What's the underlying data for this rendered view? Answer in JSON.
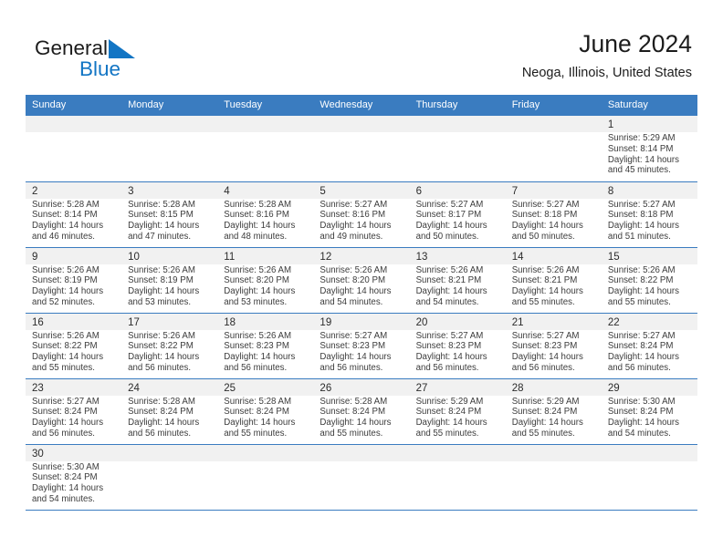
{
  "brand": {
    "name_dark": "General",
    "name_light": "Blue",
    "flag_icon": "blue-triangle-flag-icon",
    "accent_color": "#1275c4"
  },
  "header": {
    "title": "June 2024",
    "subtitle": "Neoga, Illinois, United States"
  },
  "theme": {
    "header_bg": "#3a7cc0",
    "header_text": "#ffffff",
    "cell_head_bg": "#f1f1f1",
    "grid_line": "#3a7cc0"
  },
  "weekdays": [
    "Sunday",
    "Monday",
    "Tuesday",
    "Wednesday",
    "Thursday",
    "Friday",
    "Saturday"
  ],
  "labels": {
    "sunrise_prefix": "Sunrise:",
    "sunset_prefix": "Sunset:",
    "daylight_prefix": "Daylight:"
  },
  "weeks": [
    [
      {
        "day": "",
        "empty": true,
        "sunrise": "",
        "sunset": "",
        "daylight_1": "",
        "daylight_2": ""
      },
      {
        "day": "",
        "empty": true,
        "sunrise": "",
        "sunset": "",
        "daylight_1": "",
        "daylight_2": ""
      },
      {
        "day": "",
        "empty": true,
        "sunrise": "",
        "sunset": "",
        "daylight_1": "",
        "daylight_2": ""
      },
      {
        "day": "",
        "empty": true,
        "sunrise": "",
        "sunset": "",
        "daylight_1": "",
        "daylight_2": ""
      },
      {
        "day": "",
        "empty": true,
        "sunrise": "",
        "sunset": "",
        "daylight_1": "",
        "daylight_2": ""
      },
      {
        "day": "",
        "empty": true,
        "sunrise": "",
        "sunset": "",
        "daylight_1": "",
        "daylight_2": ""
      },
      {
        "day": "1",
        "empty": false,
        "sunrise": "Sunrise: 5:29 AM",
        "sunset": "Sunset: 8:14 PM",
        "daylight_1": "Daylight: 14 hours",
        "daylight_2": "and 45 minutes."
      }
    ],
    [
      {
        "day": "2",
        "empty": false,
        "sunrise": "Sunrise: 5:28 AM",
        "sunset": "Sunset: 8:14 PM",
        "daylight_1": "Daylight: 14 hours",
        "daylight_2": "and 46 minutes."
      },
      {
        "day": "3",
        "empty": false,
        "sunrise": "Sunrise: 5:28 AM",
        "sunset": "Sunset: 8:15 PM",
        "daylight_1": "Daylight: 14 hours",
        "daylight_2": "and 47 minutes."
      },
      {
        "day": "4",
        "empty": false,
        "sunrise": "Sunrise: 5:28 AM",
        "sunset": "Sunset: 8:16 PM",
        "daylight_1": "Daylight: 14 hours",
        "daylight_2": "and 48 minutes."
      },
      {
        "day": "5",
        "empty": false,
        "sunrise": "Sunrise: 5:27 AM",
        "sunset": "Sunset: 8:16 PM",
        "daylight_1": "Daylight: 14 hours",
        "daylight_2": "and 49 minutes."
      },
      {
        "day": "6",
        "empty": false,
        "sunrise": "Sunrise: 5:27 AM",
        "sunset": "Sunset: 8:17 PM",
        "daylight_1": "Daylight: 14 hours",
        "daylight_2": "and 50 minutes."
      },
      {
        "day": "7",
        "empty": false,
        "sunrise": "Sunrise: 5:27 AM",
        "sunset": "Sunset: 8:18 PM",
        "daylight_1": "Daylight: 14 hours",
        "daylight_2": "and 50 minutes."
      },
      {
        "day": "8",
        "empty": false,
        "sunrise": "Sunrise: 5:27 AM",
        "sunset": "Sunset: 8:18 PM",
        "daylight_1": "Daylight: 14 hours",
        "daylight_2": "and 51 minutes."
      }
    ],
    [
      {
        "day": "9",
        "empty": false,
        "sunrise": "Sunrise: 5:26 AM",
        "sunset": "Sunset: 8:19 PM",
        "daylight_1": "Daylight: 14 hours",
        "daylight_2": "and 52 minutes."
      },
      {
        "day": "10",
        "empty": false,
        "sunrise": "Sunrise: 5:26 AM",
        "sunset": "Sunset: 8:19 PM",
        "daylight_1": "Daylight: 14 hours",
        "daylight_2": "and 53 minutes."
      },
      {
        "day": "11",
        "empty": false,
        "sunrise": "Sunrise: 5:26 AM",
        "sunset": "Sunset: 8:20 PM",
        "daylight_1": "Daylight: 14 hours",
        "daylight_2": "and 53 minutes."
      },
      {
        "day": "12",
        "empty": false,
        "sunrise": "Sunrise: 5:26 AM",
        "sunset": "Sunset: 8:20 PM",
        "daylight_1": "Daylight: 14 hours",
        "daylight_2": "and 54 minutes."
      },
      {
        "day": "13",
        "empty": false,
        "sunrise": "Sunrise: 5:26 AM",
        "sunset": "Sunset: 8:21 PM",
        "daylight_1": "Daylight: 14 hours",
        "daylight_2": "and 54 minutes."
      },
      {
        "day": "14",
        "empty": false,
        "sunrise": "Sunrise: 5:26 AM",
        "sunset": "Sunset: 8:21 PM",
        "daylight_1": "Daylight: 14 hours",
        "daylight_2": "and 55 minutes."
      },
      {
        "day": "15",
        "empty": false,
        "sunrise": "Sunrise: 5:26 AM",
        "sunset": "Sunset: 8:22 PM",
        "daylight_1": "Daylight: 14 hours",
        "daylight_2": "and 55 minutes."
      }
    ],
    [
      {
        "day": "16",
        "empty": false,
        "sunrise": "Sunrise: 5:26 AM",
        "sunset": "Sunset: 8:22 PM",
        "daylight_1": "Daylight: 14 hours",
        "daylight_2": "and 55 minutes."
      },
      {
        "day": "17",
        "empty": false,
        "sunrise": "Sunrise: 5:26 AM",
        "sunset": "Sunset: 8:22 PM",
        "daylight_1": "Daylight: 14 hours",
        "daylight_2": "and 56 minutes."
      },
      {
        "day": "18",
        "empty": false,
        "sunrise": "Sunrise: 5:26 AM",
        "sunset": "Sunset: 8:23 PM",
        "daylight_1": "Daylight: 14 hours",
        "daylight_2": "and 56 minutes."
      },
      {
        "day": "19",
        "empty": false,
        "sunrise": "Sunrise: 5:27 AM",
        "sunset": "Sunset: 8:23 PM",
        "daylight_1": "Daylight: 14 hours",
        "daylight_2": "and 56 minutes."
      },
      {
        "day": "20",
        "empty": false,
        "sunrise": "Sunrise: 5:27 AM",
        "sunset": "Sunset: 8:23 PM",
        "daylight_1": "Daylight: 14 hours",
        "daylight_2": "and 56 minutes."
      },
      {
        "day": "21",
        "empty": false,
        "sunrise": "Sunrise: 5:27 AM",
        "sunset": "Sunset: 8:23 PM",
        "daylight_1": "Daylight: 14 hours",
        "daylight_2": "and 56 minutes."
      },
      {
        "day": "22",
        "empty": false,
        "sunrise": "Sunrise: 5:27 AM",
        "sunset": "Sunset: 8:24 PM",
        "daylight_1": "Daylight: 14 hours",
        "daylight_2": "and 56 minutes."
      }
    ],
    [
      {
        "day": "23",
        "empty": false,
        "sunrise": "Sunrise: 5:27 AM",
        "sunset": "Sunset: 8:24 PM",
        "daylight_1": "Daylight: 14 hours",
        "daylight_2": "and 56 minutes."
      },
      {
        "day": "24",
        "empty": false,
        "sunrise": "Sunrise: 5:28 AM",
        "sunset": "Sunset: 8:24 PM",
        "daylight_1": "Daylight: 14 hours",
        "daylight_2": "and 56 minutes."
      },
      {
        "day": "25",
        "empty": false,
        "sunrise": "Sunrise: 5:28 AM",
        "sunset": "Sunset: 8:24 PM",
        "daylight_1": "Daylight: 14 hours",
        "daylight_2": "and 55 minutes."
      },
      {
        "day": "26",
        "empty": false,
        "sunrise": "Sunrise: 5:28 AM",
        "sunset": "Sunset: 8:24 PM",
        "daylight_1": "Daylight: 14 hours",
        "daylight_2": "and 55 minutes."
      },
      {
        "day": "27",
        "empty": false,
        "sunrise": "Sunrise: 5:29 AM",
        "sunset": "Sunset: 8:24 PM",
        "daylight_1": "Daylight: 14 hours",
        "daylight_2": "and 55 minutes."
      },
      {
        "day": "28",
        "empty": false,
        "sunrise": "Sunrise: 5:29 AM",
        "sunset": "Sunset: 8:24 PM",
        "daylight_1": "Daylight: 14 hours",
        "daylight_2": "and 55 minutes."
      },
      {
        "day": "29",
        "empty": false,
        "sunrise": "Sunrise: 5:30 AM",
        "sunset": "Sunset: 8:24 PM",
        "daylight_1": "Daylight: 14 hours",
        "daylight_2": "and 54 minutes."
      }
    ],
    [
      {
        "day": "30",
        "empty": false,
        "sunrise": "Sunrise: 5:30 AM",
        "sunset": "Sunset: 8:24 PM",
        "daylight_1": "Daylight: 14 hours",
        "daylight_2": "and 54 minutes."
      },
      {
        "day": "",
        "empty": true,
        "sunrise": "",
        "sunset": "",
        "daylight_1": "",
        "daylight_2": ""
      },
      {
        "day": "",
        "empty": true,
        "sunrise": "",
        "sunset": "",
        "daylight_1": "",
        "daylight_2": ""
      },
      {
        "day": "",
        "empty": true,
        "sunrise": "",
        "sunset": "",
        "daylight_1": "",
        "daylight_2": ""
      },
      {
        "day": "",
        "empty": true,
        "sunrise": "",
        "sunset": "",
        "daylight_1": "",
        "daylight_2": ""
      },
      {
        "day": "",
        "empty": true,
        "sunrise": "",
        "sunset": "",
        "daylight_1": "",
        "daylight_2": ""
      },
      {
        "day": "",
        "empty": true,
        "sunrise": "",
        "sunset": "",
        "daylight_1": "",
        "daylight_2": ""
      }
    ]
  ]
}
